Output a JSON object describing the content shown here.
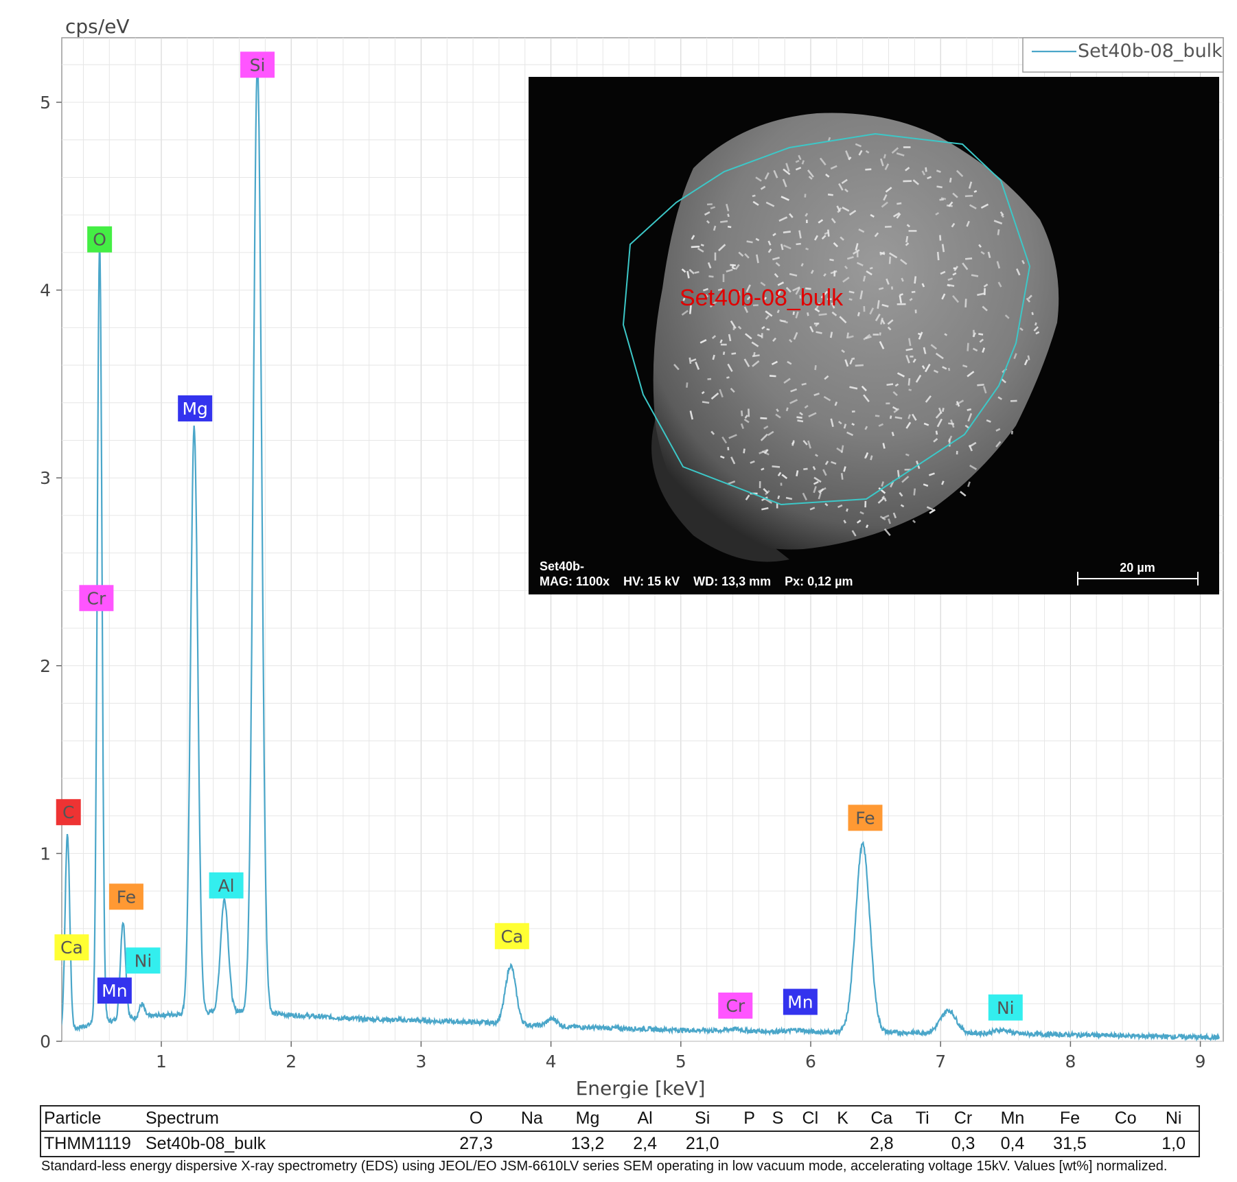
{
  "chart_data": {
    "type": "line",
    "ylabel": "cps/eV",
    "xlabel": "Energie [keV]",
    "xlim": [
      0.2,
      9.15
    ],
    "ylim": [
      0,
      5.3
    ],
    "xticks": [
      1,
      2,
      3,
      4,
      5,
      6,
      7,
      8,
      9
    ],
    "yticks": [
      0,
      1,
      2,
      3,
      4,
      5
    ],
    "grid": true,
    "legend_position": "top-right",
    "series": [
      {
        "name": "Set40b-08_bulk",
        "color": "#4aa6c9",
        "baseline": [
          [
            0.2,
            0.04
          ],
          [
            0.5,
            0.1
          ],
          [
            1.0,
            0.14
          ],
          [
            1.6,
            0.16
          ],
          [
            2.0,
            0.14
          ],
          [
            2.5,
            0.12
          ],
          [
            3.0,
            0.11
          ],
          [
            3.5,
            0.1
          ],
          [
            4.0,
            0.08
          ],
          [
            4.5,
            0.07
          ],
          [
            5.0,
            0.06
          ],
          [
            5.5,
            0.055
          ],
          [
            6.0,
            0.05
          ],
          [
            7.0,
            0.045
          ],
          [
            8.0,
            0.035
          ],
          [
            9.15,
            0.02
          ]
        ],
        "peaks": [
          {
            "element": "C",
            "energy": 0.277,
            "height": 1.05,
            "width": 0.018
          },
          {
            "element": "O",
            "energy": 0.525,
            "height": 4.15,
            "width": 0.018
          },
          {
            "element": "Fe L",
            "energy": 0.705,
            "height": 0.52,
            "width": 0.02
          },
          {
            "element": "Ni L",
            "energy": 0.85,
            "height": 0.07,
            "width": 0.02
          },
          {
            "element": "Mg",
            "energy": 1.253,
            "height": 3.12,
            "width": 0.028
          },
          {
            "element": "Al",
            "energy": 1.486,
            "height": 0.6,
            "width": 0.03
          },
          {
            "element": "Si",
            "energy": 1.74,
            "height": 5.05,
            "width": 0.032
          },
          {
            "element": "Ca",
            "energy": 3.69,
            "height": 0.31,
            "width": 0.04
          },
          {
            "element": "Ca Kb",
            "energy": 4.01,
            "height": 0.04,
            "width": 0.04
          },
          {
            "element": "Cr",
            "energy": 5.41,
            "height": 0.01,
            "width": 0.05
          },
          {
            "element": "Mn",
            "energy": 5.9,
            "height": 0.01,
            "width": 0.05
          },
          {
            "element": "Fe",
            "energy": 6.4,
            "height": 1.0,
            "width": 0.055
          },
          {
            "element": "Fe Kb",
            "energy": 7.06,
            "height": 0.12,
            "width": 0.06
          },
          {
            "element": "Ni",
            "energy": 7.47,
            "height": 0.02,
            "width": 0.06
          }
        ]
      }
    ],
    "peak_labels": [
      {
        "text": "Si",
        "energy": 1.74,
        "y": 5.2,
        "bg": "#ff55ff"
      },
      {
        "text": "O",
        "energy": 0.525,
        "y": 4.27,
        "bg": "#44ee44"
      },
      {
        "text": "Mg",
        "energy": 1.26,
        "y": 3.37,
        "bg": "#3333ee",
        "fg": "#ffffff"
      },
      {
        "text": "Cr",
        "energy": 0.5,
        "y": 2.36,
        "bg": "#ff55ff"
      },
      {
        "text": "C",
        "energy": 0.285,
        "y": 1.22,
        "bg": "#ee3333"
      },
      {
        "text": "Fe",
        "energy": 6.42,
        "y": 1.19,
        "bg": "#ff9933"
      },
      {
        "text": "Al",
        "energy": 1.5,
        "y": 0.83,
        "bg": "#33eeee"
      },
      {
        "text": "Fe",
        "energy": 0.73,
        "y": 0.77,
        "bg": "#ff9933"
      },
      {
        "text": "Ca",
        "energy": 3.7,
        "y": 0.56,
        "bg": "#ffff33"
      },
      {
        "text": "Ca",
        "energy": 0.31,
        "y": 0.5,
        "bg": "#ffff33"
      },
      {
        "text": "Ni",
        "energy": 0.86,
        "y": 0.43,
        "bg": "#33eeee"
      },
      {
        "text": "Mn",
        "energy": 0.64,
        "y": 0.27,
        "bg": "#3333ee",
        "fg": "#ffffff"
      },
      {
        "text": "Cr",
        "energy": 5.42,
        "y": 0.19,
        "bg": "#ff55ff"
      },
      {
        "text": "Mn",
        "energy": 5.92,
        "y": 0.21,
        "bg": "#3333ee",
        "fg": "#ffffff"
      },
      {
        "text": "Ni",
        "energy": 7.5,
        "y": 0.18,
        "bg": "#33eeee"
      }
    ]
  },
  "sem_image": {
    "region_label": "Set40b-08_bulk",
    "line1": "Set40b-",
    "info": "MAG: 1100x    HV: 15 kV    WD: 13,3 mm    Px: 0,12 µm",
    "scale_label": "20 µm",
    "outline_color": "#3cc8c8"
  },
  "table": {
    "headers": [
      "Particle",
      "Spectrum",
      "O",
      "Na",
      "Mg",
      "Al",
      "Si",
      "P",
      "S",
      "Cl",
      "K",
      "Ca",
      "Ti",
      "Cr",
      "Mn",
      "Fe",
      "Co",
      "Ni"
    ],
    "rows": [
      [
        "THMM1119",
        "Set40b-08_bulk",
        "27,3",
        "",
        "13,2",
        "2,4",
        "21,0",
        "",
        "",
        "",
        "",
        "2,8",
        "",
        "0,3",
        "0,4",
        "31,5",
        "",
        "1,0"
      ]
    ]
  },
  "footnote": "Standard-less energy dispersive X-ray spectrometry (EDS) using JEOL/EO JSM-6610LV series SEM operating in low vacuum mode, accelerating voltage 15kV. Values [wt%] normalized."
}
